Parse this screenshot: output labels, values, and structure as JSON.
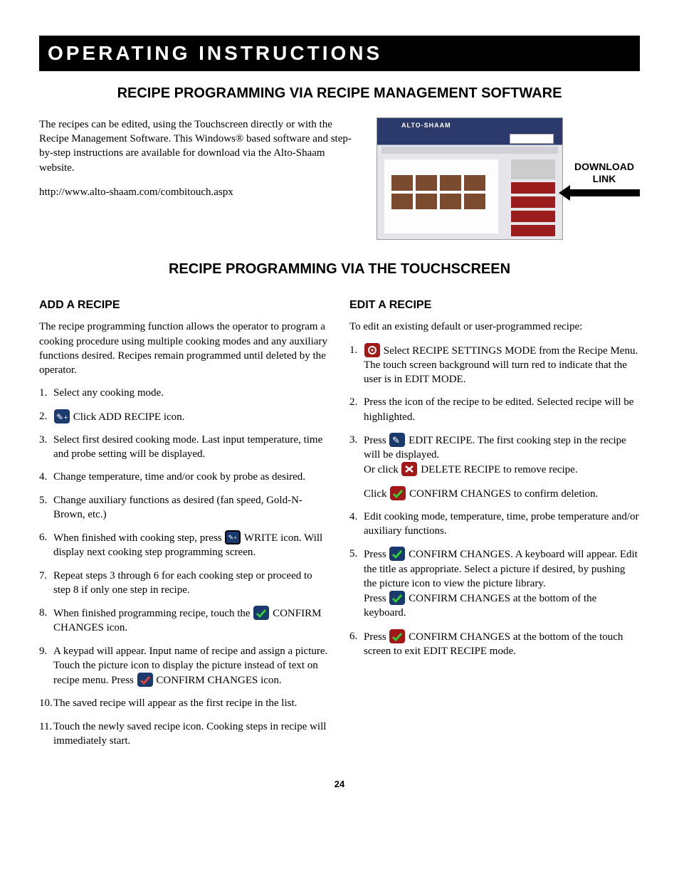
{
  "banner": "OPERATING INSTRUCTIONS",
  "section1_title": "RECIPE PROGRAMMING VIA RECIPE MANAGEMENT SOFTWARE",
  "intro_para": "The recipes can be edited, using the Touchscreen directly or with the Recipe Management Software.  This Windows® based software and step-by-step instructions are available for download via the Alto-Shaam website.",
  "intro_url": "http://www.alto-shaam.com/combitouch.aspx",
  "download_label_line1": "DOWNLOAD",
  "download_label_line2": "LINK",
  "section2_title": "RECIPE PROGRAMMING VIA THE TOUCHSCREEN",
  "add": {
    "heading": "ADD A RECIPE",
    "intro": "The recipe programming function allows the operator to program a cooking procedure using multiple cooking modes and any auxiliary functions desired. Recipes remain programmed until deleted by the operator.",
    "step1": "Select any cooking mode.",
    "step2_after_icon": " Click ADD RECIPE icon.",
    "step3": "Select first desired cooking mode. Last input temperature, time and probe setting will be displayed.",
    "step4": "Change temperature, time and/or cook by probe as desired.",
    "step5": "Change auxiliary functions as desired (fan speed, Gold-N-Brown, etc.)",
    "step6_before_icon": "When finished with cooking step, press ",
    "step6_after_icon": "  WRITE icon. Will display next cooking step programming screen.",
    "step7": "Repeat steps 3 through 6 for each cooking step or proceed to step 8 if only one step in recipe.",
    "step8_before_icon": "When finished programming recipe, touch the ",
    "step8_after_icon": " CONFIRM CHANGES icon.",
    "step9_before_icon": "A keypad will appear. Input name of recipe and assign a picture. Touch the picture icon to display the picture instead of text on recipe menu. Press ",
    "step9_after_icon": "  CONFIRM CHANGES icon.",
    "step10": "The saved recipe will appear as the first recipe in the list.",
    "step11": "Touch the newly saved recipe icon. Cooking steps in recipe will immediately start."
  },
  "edit": {
    "heading": "EDIT A RECIPE",
    "intro": "To edit an existing default or user-programmed recipe:",
    "step1_after_icon": " Select RECIPE SETTINGS MODE from the Recipe Menu. The touch screen background will turn red to indicate that the user is in EDIT MODE.",
    "step2": "Press the icon of the recipe to be edited. Selected recipe will be highlighted.",
    "step3_before": "Press ",
    "step3_after": " EDIT RECIPE. The first cooking step in the recipe will be displayed.",
    "step3_or_before": "Or click ",
    "step3_or_after": " DELETE RECIPE to remove recipe.",
    "step3_click_before": "Click ",
    "step3_click_after": " CONFIRM CHANGES to confirm deletion.",
    "step4": "Edit cooking mode, temperature, time, probe temperature and/or auxiliary functions.",
    "step5_before": "Press ",
    "step5_after": " CONFIRM CHANGES. A keyboard will appear. Edit the title as appropriate. Select a picture if desired, by pushing the picture icon to view the picture library.",
    "step5_press_before": "Press ",
    "step5_press_after": " CONFIRM CHANGES at the bottom of the keyboard.",
    "step6_before": "Press ",
    "step6_after": " CONFIRM CHANGES at the bottom of the touch screen to exit EDIT RECIPE mode."
  },
  "page_number": "24"
}
